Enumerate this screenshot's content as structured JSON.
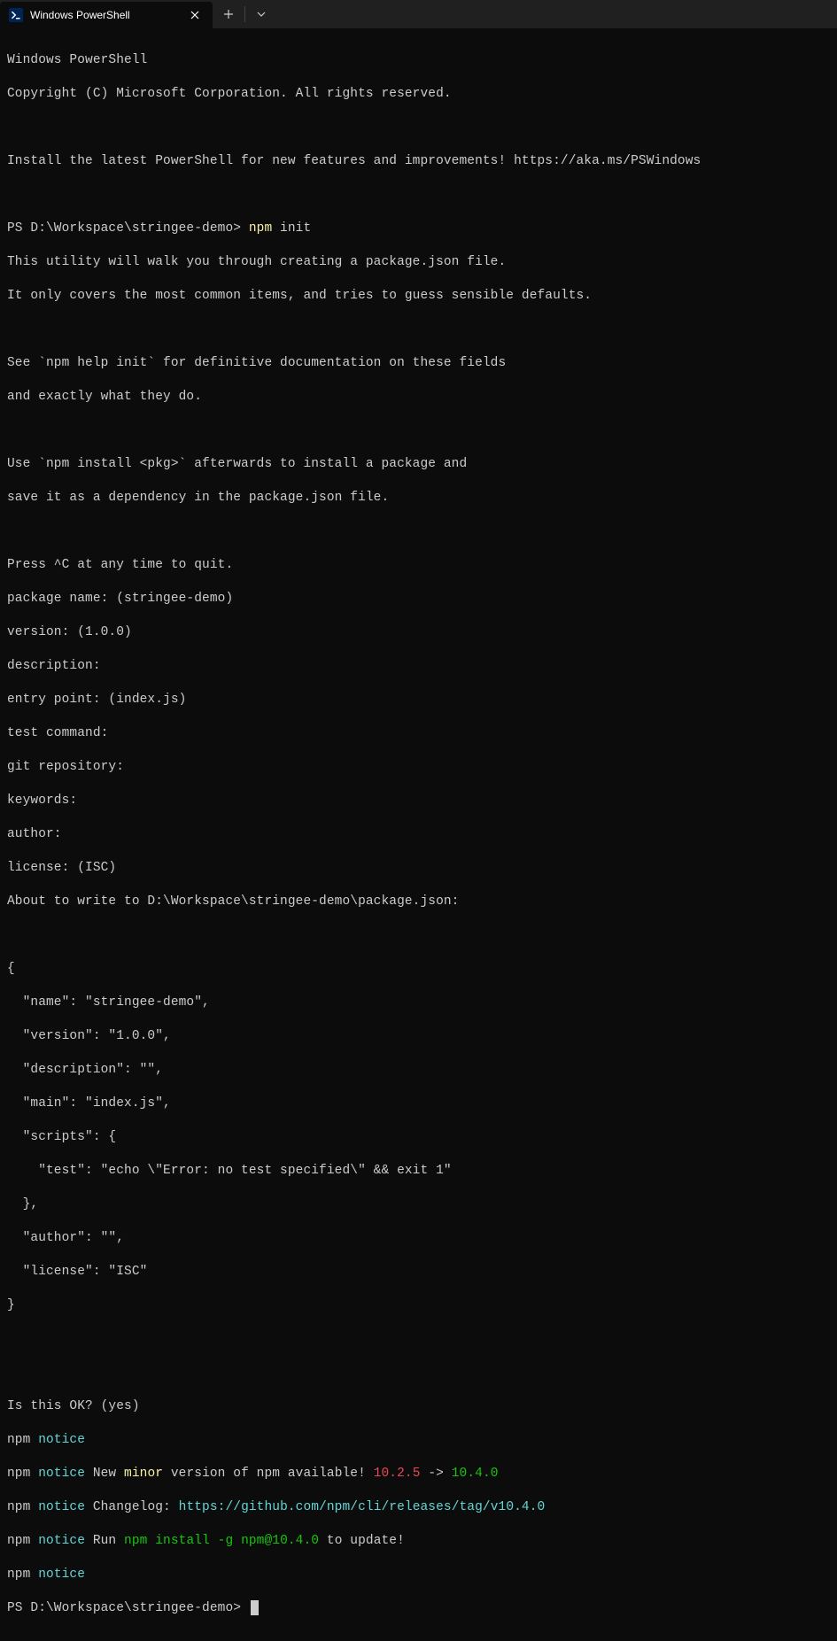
{
  "tab": {
    "title": "Windows PowerShell"
  },
  "lines": {
    "l1": "Windows PowerShell",
    "l2": "Copyright (C) Microsoft Corporation. All rights reserved.",
    "l3": "Install the latest PowerShell for new features and improvements! https://aka.ms/PSWindows",
    "prompt1_prefix": "PS D:\\Workspace\\stringee-demo> ",
    "prompt1_cmd": "npm",
    "prompt1_args": " init",
    "u1": "This utility will walk you through creating a package.json file.",
    "u2": "It only covers the most common items, and tries to guess sensible defaults.",
    "u3": "See `npm help init` for definitive documentation on these fields",
    "u4": "and exactly what they do.",
    "u5": "Use `npm install <pkg>` afterwards to install a package and",
    "u6": "save it as a dependency in the package.json file.",
    "u7": "Press ^C at any time to quit.",
    "p1": "package name: (stringee-demo)",
    "p2": "version: (1.0.0)",
    "p3": "description:",
    "p4": "entry point: (index.js)",
    "p5": "test command:",
    "p6": "git repository:",
    "p7": "keywords:",
    "p8": "author:",
    "p9": "license: (ISC)",
    "p10": "About to write to D:\\Workspace\\stringee-demo\\package.json:",
    "j1": "{",
    "j2": "  \"name\": \"stringee-demo\",",
    "j3": "  \"version\": \"1.0.0\",",
    "j4": "  \"description\": \"\",",
    "j5": "  \"main\": \"index.js\",",
    "j6": "  \"scripts\": {",
    "j7": "    \"test\": \"echo \\\"Error: no test specified\\\" && exit 1\"",
    "j8": "  },",
    "j9": "  \"author\": \"\",",
    "j10": "  \"license\": \"ISC\"",
    "j11": "}",
    "ok": "Is this OK? (yes)",
    "npm_label": "npm ",
    "notice": "notice",
    "n_new": " New ",
    "n_minor": "minor",
    "n_avail": " version of npm available! ",
    "n_oldv": "10.2.5",
    "n_arrow": " -> ",
    "n_newv": "10.4.0",
    "n_chlog": " Changelog: ",
    "n_chlog_url": "https://github.com/npm/cli/releases/tag/v10.4.0",
    "n_run": " Run ",
    "n_runcmd": "npm install -g npm@10.4.0",
    "n_update": " to update!",
    "prompt2": "PS D:\\Workspace\\stringee-demo> "
  }
}
